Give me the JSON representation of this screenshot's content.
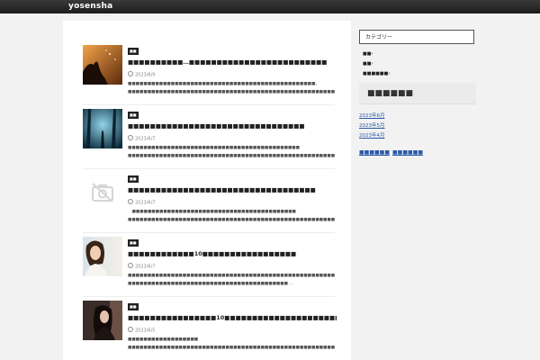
{
  "site": {
    "title": "yosensha"
  },
  "posts": [
    {
      "category": "■■",
      "title": "■■■■■■■■■■…■■■■■■■■■■■■■■■■■■■■■■■■■",
      "date": "2023/6/9",
      "excerpt": "■■■■■■■■■■■■■■■■■■■■■■■■■■■■■■■■■■■■■■■■■■■■■■■■。■■■■■■■■■■■■■■■■■■■■■■■■■■■■■■■■■■■■■■■■■■■■■■■■■■■■■■■■■■■■ …",
      "thumb": "silhouette-warm"
    },
    {
      "category": "■■",
      "title": "■■■■■■■■■■■■■■■■■■■■■■■■■■■■■■■■",
      "date": "2023/6/7",
      "excerpt": "■■■■■■■■■■■■■■■■■■■■■■■■■■■■■■■■■■■■■■■■■■■■ ■■■■■■■■■■■■■■■■■■■■■■■■■■■■■■■■■■■■■■■■■■■■■■■■■■■■■■■■■■■■■■■■■■■■■■■　■■ …",
      "thumb": "forest-blue"
    },
    {
      "category": "■■",
      "title": "■■■■■■■■■■■■■■■■■■■■■■■■■■■■■■■■■■",
      "date": "2023/6/7",
      "excerpt": "　■■■■■■■■■■■■■■■■■■■■■■■■■■■■■■■■■■■■■■■■■■ ■■■■■■■■■■■■■■■■■■■■■■■■■■■■■■■■■■■■■■■■■■■■■■■■■■■■■■■■■■■■■■■■■■■■ …",
      "thumb": "no-image"
    },
    {
      "category": "■■",
      "title": "■■■■■■■■■■■■10■■■■■■■■■■■■■■■■■",
      "date": "2023/6/7",
      "excerpt": "■■■■■■■■■■■■■■■■■■■■■■■■■■■■■■■■■■■■■■■■■■■■■■■■■■■■■■■■■■■■■■■■■■■■■ ■■■■■■■■■■■■■■■■■■■■■■■■■■■■■■■■■■■■■■■■■ …",
      "thumb": "portrait-light"
    },
    {
      "category": "■■",
      "title": "■■■■■■■■■■■■■■■■10■■■■■■■■■■■■■■■■■■■■■■",
      "date": "2023/6/5",
      "excerpt": "■■■■■■■■■■■■■■■■■■ ■■■■■■■■■■■■■■■■■■■■■■■■■■■■■■■■■■■■■■■■■■■■■■■■■■■■■■■■■■■■■■■■■■■■■ ■■■■■■■■■■■■■■■■■■■ …",
      "thumb": "portrait-dark"
    }
  ],
  "sidebar": {
    "category_heading": "カテゴリー",
    "categories": [
      "■■›",
      "■■›",
      "■■■■■■›"
    ],
    "archive_heading": "■■■■■■",
    "archives": [
      "2023年6月",
      "2023年5月",
      "2023年4月"
    ],
    "tags": [
      "■■■■■■",
      "■■■■■■"
    ]
  },
  "colors": {
    "topbar": "#262626",
    "link": "#2a5aa8",
    "category_badge": "#222222"
  }
}
